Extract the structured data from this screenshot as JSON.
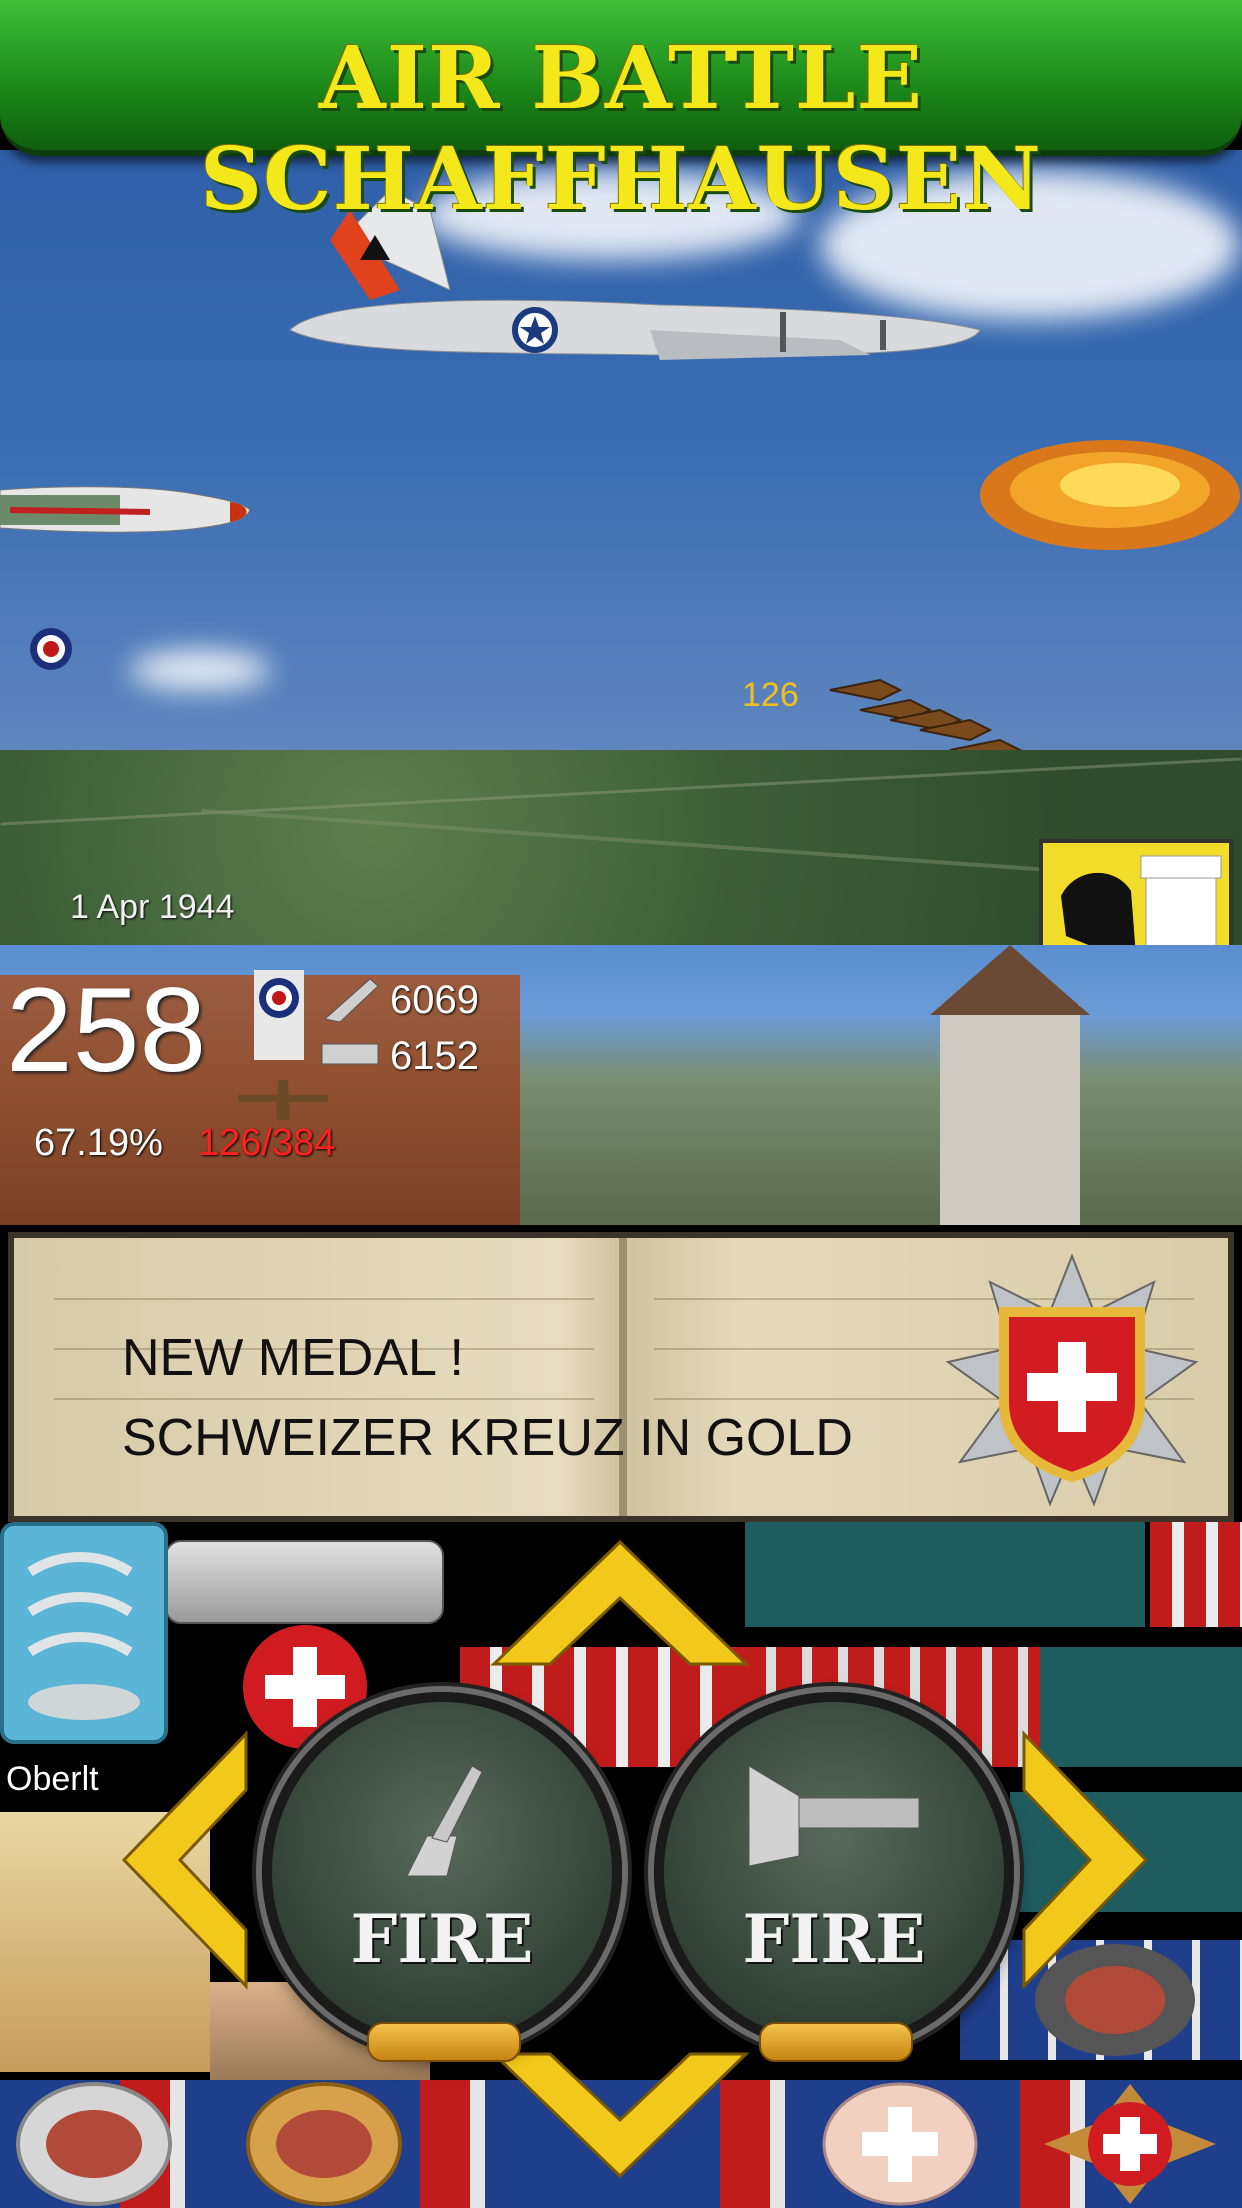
{
  "title": "AIR BATTLE SCHAFFHAUSEN",
  "sky": {
    "counter": "126"
  },
  "terrain": {
    "date": "1 Apr 1944"
  },
  "stats": {
    "score": "258",
    "stat_a": "6069",
    "stat_b": "6152",
    "percent": "67.19%",
    "ratio": "126/384"
  },
  "notification": {
    "title": "NEW MEDAL !",
    "medal_name": "SCHWEIZER KREUZ IN GOLD"
  },
  "controls": {
    "fire_left_label": "FIRE",
    "fire_right_label": "FIRE",
    "rank": "Oberlt"
  },
  "colors": {
    "banner_green": "#1d8c1a",
    "title_yellow": "#f4e81a",
    "ratio_red": "#ff2020",
    "arrow_gold": "#f2c81a"
  },
  "icons": [
    "raf-roundel-icon",
    "bomber-icon",
    "fighter-icon",
    "schaffhausen-crest-icon",
    "swiss-cross-medal-icon",
    "rank-insignia-icon",
    "fire-machinegun-icon",
    "fire-cannon-icon",
    "arrow-up-icon",
    "arrow-down-icon",
    "arrow-left-icon",
    "arrow-right-icon"
  ]
}
